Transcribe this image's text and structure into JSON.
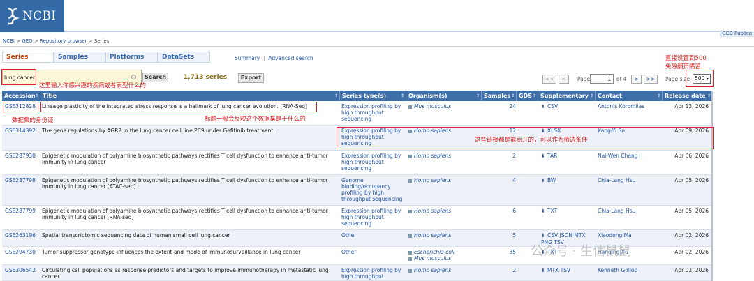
{
  "header": {
    "logo_text": "NCBI",
    "right_label": "GEO Publica"
  },
  "breadcrumb": [
    "NCBI",
    "GEO",
    "Repository browser",
    "Series"
  ],
  "tabs": [
    "Series",
    "Samples",
    "Platforms",
    "DataSets"
  ],
  "links": {
    "summary": "Summary",
    "advanced": "Advanced search"
  },
  "search": {
    "value": "lung cancer",
    "button": "Search",
    "count": "1,713 series",
    "export": "Export"
  },
  "annotations": {
    "search_hint": "这里输入你感兴趣的疾病或者表型什么的",
    "page_size_hint_1": "直接设置到500",
    "page_size_hint_2": "免除翻页痛苦",
    "accession_hint": "数据集的身份证",
    "title_hint": "标题一般会反映这个数据集是干什么的",
    "links_hint": "这些链接都是能点开的，可以作为筛选条件"
  },
  "pager": {
    "first": "<<",
    "prev": "<",
    "page_label": "Page",
    "page": "1",
    "of": "of 4",
    "next": ">",
    "last": ">>",
    "page_size_label": "Page size",
    "page_size": "500"
  },
  "table": {
    "headers": [
      "Accession",
      "Title",
      "Series type(s)",
      "Organism(s)",
      "Samples",
      "GDS",
      "Supplementary",
      "Contact",
      "Release date"
    ],
    "rows": [
      {
        "accession": "GSE312828",
        "title": "Lineage plasticity of the integrated stress response is a hallmark of lung cancer evolution. [RNA-Seq]",
        "type": "Expression profiling by high throughput sequencing",
        "organism": "Mus musculus",
        "samples": "24",
        "supp": "CSV",
        "contact": "Antonis Koromilas",
        "date": "Apr 12, 2026"
      },
      {
        "accession": "GSE314392",
        "title": "The gene regulations by AGR2 in the lung cancer cell line PC9 under Gefitinib treatment.",
        "type": "Expression profiling by high throughput sequencing",
        "organism": "Homo sapiens",
        "samples": "12",
        "supp": "XLSX",
        "contact": "Kang-Yi Su",
        "date": "Apr 09, 2026"
      },
      {
        "accession": "GSE287930",
        "title": "Epigenetic modulation of polyamine biosynthetic pathways rectifies T cell dysfunction to enhance anti-tumor immunity in lung cancer",
        "type": "Expression profiling by high throughput sequencing",
        "organism": "Homo sapiens",
        "samples": "2",
        "supp": "TAR",
        "contact": "Nai-Wen Chang",
        "date": "Apr 06, 2026"
      },
      {
        "accession": "GSE287798",
        "title": "Epigenetic modulation of polyamine biosynthetic pathways rectifies T cell dysfunction to enhance anti-tumor immunity in lung cancer [ATAC-seq]",
        "type": "Genome binding/occupancy profiling by high throughput sequencing",
        "organism": "Homo sapiens",
        "samples": "4",
        "supp": "BW",
        "contact": "Chia-Lang Hsu",
        "date": "Apr 05, 2026"
      },
      {
        "accession": "GSE287799",
        "title": "Epigenetic modulation of polyamine biosynthetic pathways rectifies T cell dysfunction to enhance anti-tumor immunity in lung cancer [RNA-seq]",
        "type": "Expression profiling by high throughput sequencing",
        "organism": "Homo sapiens",
        "samples": "6",
        "supp": "TXT",
        "contact": "Chia-Lang Hsu",
        "date": "Apr 05, 2026"
      },
      {
        "accession": "GSE263196",
        "title": "Spatial transcriptomic sequencing data of human small cell lung cancer",
        "type": "Other",
        "organism": "Homo sapiens",
        "samples": "5",
        "supp": "CSV JSON MTX PNG TSV",
        "contact": "Xiaodong Ma",
        "date": "Apr 02, 2026"
      },
      {
        "accession": "GSE294730",
        "title": "Tumor suppressor genotype influences the extent and mode of immunosurveillance in lung cancer",
        "type": "Other",
        "organism": "Escherichia coli",
        "organism2": "Mus musculus",
        "samples": "35",
        "supp": "TXT",
        "contact": "Hanqing Xu",
        "date": "Apr 02, 2026"
      },
      {
        "accession": "GSE306542",
        "title": "Circulating cell populations as response predictors and targets to improve immunotherapy in metastatic lung cancer",
        "type": "Expression profiling by high throughput",
        "organism": "Homo sapiens",
        "samples": "2",
        "supp": "MTX TSV",
        "contact": "Kenneth Gollob",
        "date": "Apr 02, 2026"
      }
    ]
  },
  "watermark": "公众号 · 生信鼠鼠"
}
